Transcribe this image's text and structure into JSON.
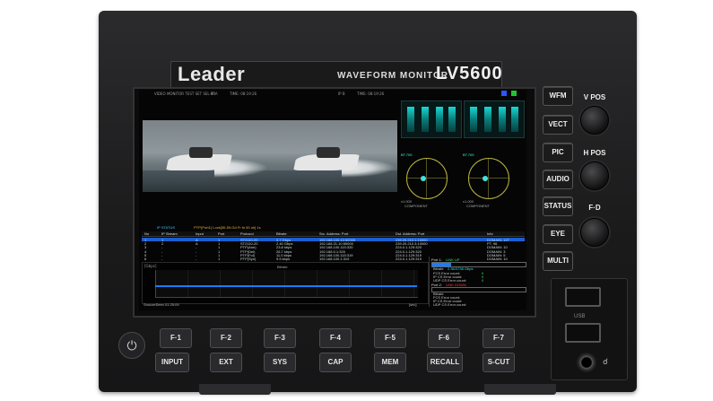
{
  "brand": "Leader",
  "device_title": "WAVEFORM MONITOR",
  "model": "LV5600",
  "screen": {
    "header_left": "VIDEO MONITOR TEST SET   SEL-10",
    "input_a": "IP A",
    "time_a": "TIME: 08:19:26",
    "input_b": "IP B",
    "time_b": "TIME: 08:19:26",
    "ip_status_title": "IP STATUS",
    "ip_status_detail": "PTP(Port1) Lock[30-59-Gd Fr fn 00 oh] 1s",
    "columns": [
      "No",
      "IP Stream",
      "Input",
      "Port",
      "Protocol",
      "Bitrate",
      "Src. Address: Port",
      "Dst. Address: Port",
      "Info"
    ],
    "rows": [
      [
        "1",
        "1",
        "A",
        "1",
        "ST2110-20",
        "3.7 Gbps",
        "192.168.100.10:50000",
        "239.20.210.1:10000",
        "DOMAIN: 127"
      ],
      [
        "2",
        "2",
        "A",
        "1",
        "ST2110-20",
        "2.40 Gbps",
        "192.168.21.10:50000",
        "239.20.210.3:10000",
        "PT: 96"
      ],
      [
        "3",
        "-",
        "-",
        "1",
        "PTP(Ann)",
        "23.8 kbps",
        "192.168.100.115:320",
        "224.0.1.129:320",
        "DOMAIN: 10"
      ],
      [
        "4",
        "-",
        "-",
        "1",
        "PTP(Del)",
        "26.7 kbps",
        "192.168.0.1:320",
        "224.0.1.129:320",
        "DOMAIN: 3"
      ],
      [
        "5",
        "-",
        "-",
        "1",
        "PTP(Fol)",
        "11.0 kbps",
        "192.168.100.115:319",
        "224.0.1.129:319",
        "DOMAIN: 5"
      ],
      [
        "6",
        "-",
        "-",
        "1",
        "PTP(Syn)",
        "9.5 kbps",
        "192.168.100.1:319",
        "224.0.1.129:319",
        "DOMAIN: 10"
      ]
    ],
    "graph_unit": "[Gbps]",
    "graph_title": "Bitrate",
    "graph_footer_left": "SnoozeSeen 01:25:09",
    "graph_footer_right": "[sec]",
    "port1_label": "Port 1:",
    "port1_status": "LINK UP",
    "bitrate_label": "Bitrate",
    "bitrate_value": "2.36/3738 Gbps",
    "fcs_label": "FCS Error count:",
    "ipcs_label": "IP CS Error count:",
    "udpcs_label": "UDP CS Error count:",
    "error_value": "0",
    "port2_label": "Port 2:",
    "port2_status": "LINK DOWN",
    "component_label": "COMPONENT",
    "vec_label": "BT.709",
    "vec_scale": "x1.000"
  },
  "side_buttons": [
    "WFM",
    "VECT",
    "PIC",
    "AUDIO",
    "STATUS",
    "EYE",
    "MULTI"
  ],
  "knobs": [
    "V POS",
    "H POS",
    "F·D"
  ],
  "function_keys": [
    "F·1",
    "F·2",
    "F·3",
    "F·4",
    "F·5",
    "F·6",
    "F·7"
  ],
  "bottom_buttons": [
    "INPUT",
    "EXT",
    "SYS",
    "CAP",
    "MEM",
    "RECALL",
    "S-CUT"
  ],
  "usb_label": "USB"
}
